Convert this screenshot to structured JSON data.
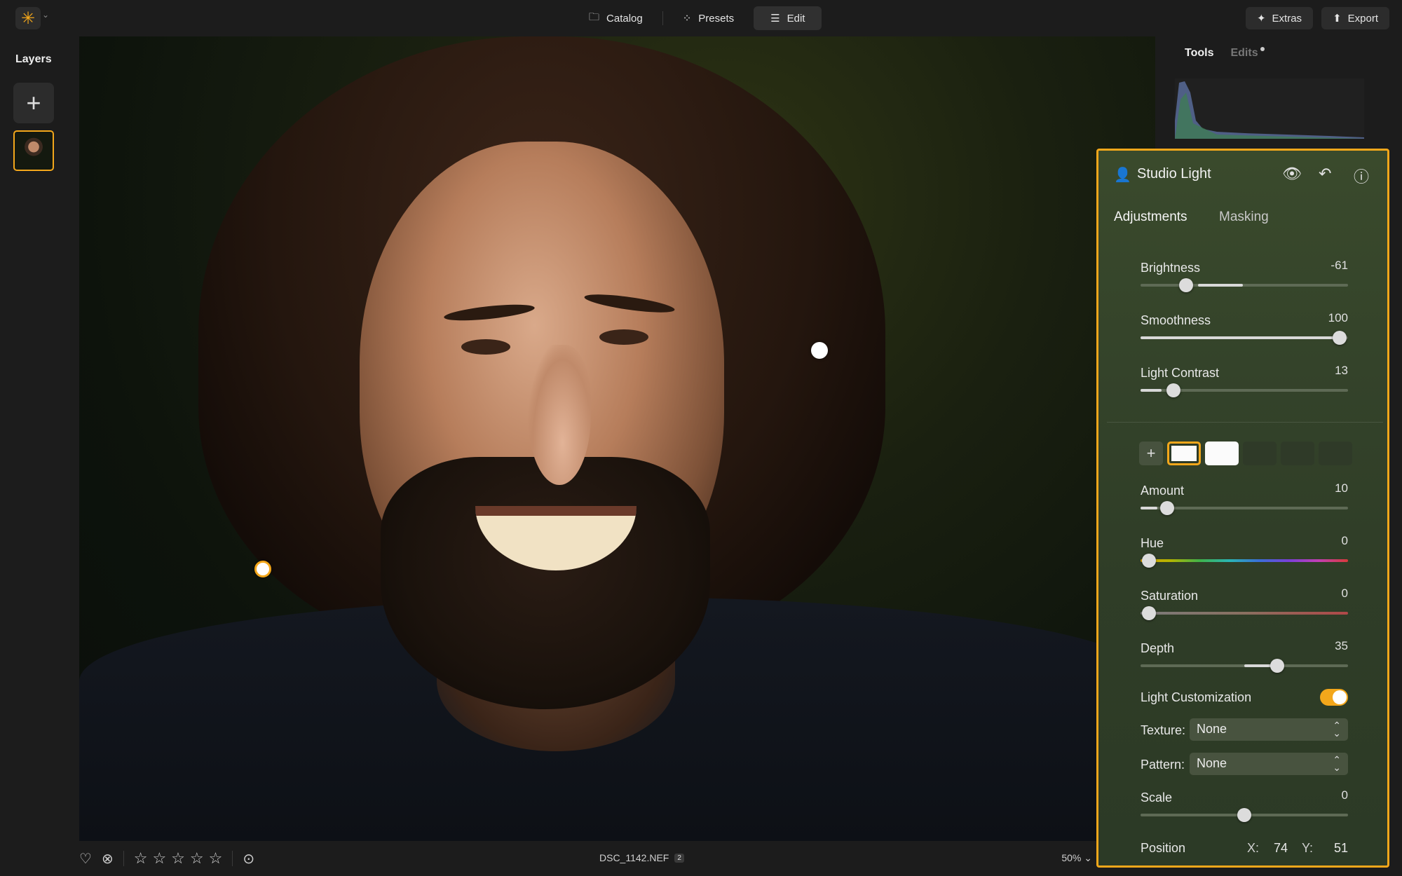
{
  "topbar": {
    "nav": [
      {
        "label": "Catalog",
        "icon": "folder-icon",
        "active": false
      },
      {
        "label": "Presets",
        "icon": "sparkle-icon",
        "active": false
      },
      {
        "label": "Edit",
        "icon": "sliders-icon",
        "active": true
      }
    ],
    "extras_label": "Extras",
    "export_label": "Export"
  },
  "layers": {
    "title": "Layers"
  },
  "sidebar": {
    "tab_tools": "Tools",
    "tab_edits": "Edits"
  },
  "panel": {
    "title": "Studio Light",
    "tabs": [
      "Adjustments",
      "Masking"
    ],
    "brightness": {
      "label": "Brightness",
      "value": "-61",
      "pos": 0.22
    },
    "smoothness": {
      "label": "Smoothness",
      "value": "100",
      "pos": 0.96
    },
    "light_contrast": {
      "label": "Light Contrast",
      "value": "13",
      "pos": 0.16
    },
    "amount": {
      "label": "Amount",
      "value": "10",
      "pos": 0.13
    },
    "hue": {
      "label": "Hue",
      "value": "0",
      "pos": 0.04
    },
    "saturation": {
      "label": "Saturation",
      "value": "0",
      "pos": 0.04
    },
    "depth": {
      "label": "Depth",
      "value": "35",
      "pos": 0.66
    },
    "light_customization": {
      "label": "Light Customization",
      "on": true
    },
    "texture": {
      "label": "Texture:",
      "value": "None"
    },
    "pattern": {
      "label": "Pattern:",
      "value": "None"
    },
    "scale": {
      "label": "Scale",
      "value": "0",
      "pos": 0.5
    },
    "position": {
      "label": "Position",
      "x_label": "X:",
      "x": "74",
      "y_label": "Y:",
      "y": "51"
    }
  },
  "bottombar": {
    "filename": "DSC_1142.NEF",
    "badge": "2",
    "zoom": "50% ⌄"
  },
  "colors": {
    "accent": "#f3a71b",
    "panel_bg": "#34432a"
  }
}
